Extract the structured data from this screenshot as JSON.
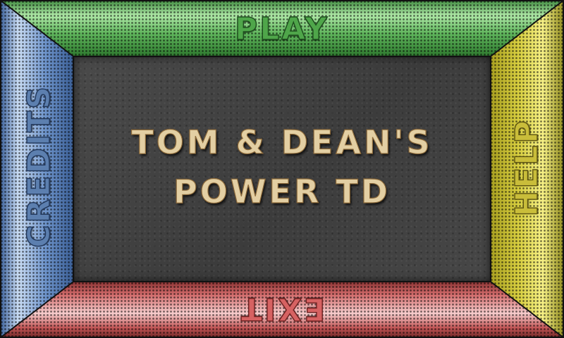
{
  "menu": {
    "play_label": "PLAY",
    "exit_label": "EXIT",
    "credits_label": "CREDITS",
    "help_label": "HELP"
  },
  "title": {
    "line1": "TOM & DEAN'S",
    "line2": "POWER TD"
  },
  "colors": {
    "play": "#4fa64a",
    "exit": "#d66262",
    "credits": "#5c7faf",
    "help": "#c9bd3a",
    "background": "#444444",
    "title_text": "#e3cfa3"
  }
}
